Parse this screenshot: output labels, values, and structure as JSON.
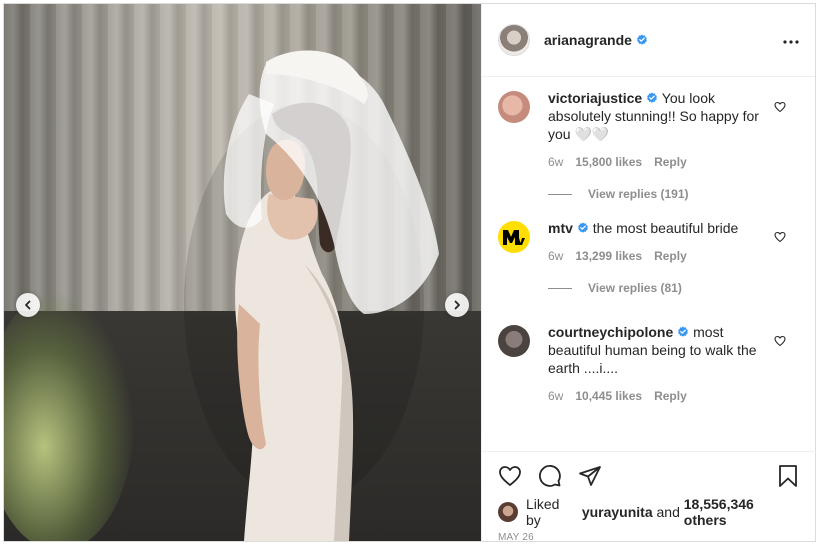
{
  "post": {
    "author": "arianagrande",
    "verified": true,
    "menu_icon": "more-horizontal-icon",
    "media": {
      "left_arrow_icon": "chevron-left-icon",
      "right_arrow_icon": "chevron-right-icon"
    }
  },
  "comments": [
    {
      "username": "victoriajustice",
      "verified": true,
      "text": "You look absolutely stunning!! So happy for you 🤍🤍",
      "age": "6w",
      "likes": "15,800 likes",
      "reply": "Reply",
      "view_replies": "View replies (191)"
    },
    {
      "username": "mtv",
      "verified": true,
      "text": "the most beautiful bride",
      "age": "6w",
      "likes": "13,299 likes",
      "reply": "Reply",
      "view_replies": "View replies (81)"
    },
    {
      "username": "courtneychipolone",
      "verified": true,
      "text": "most beautiful human being to walk the earth ....i....",
      "age": "6w",
      "likes": "10,445 likes",
      "reply": "Reply"
    }
  ],
  "actions": {
    "like_icon": "heart-icon",
    "comment_icon": "comment-icon",
    "share_icon": "share-icon",
    "save_icon": "bookmark-icon"
  },
  "liked_by": {
    "prefix": "Liked by",
    "user": "yurayunita",
    "conjunction": "and",
    "others": "18,556,346 others"
  },
  "date": "MAY 26",
  "colors": {
    "verified_blue": "#3897f0",
    "text": "#262626",
    "muted": "#8e8e8e",
    "border": "#dbdbdb"
  }
}
